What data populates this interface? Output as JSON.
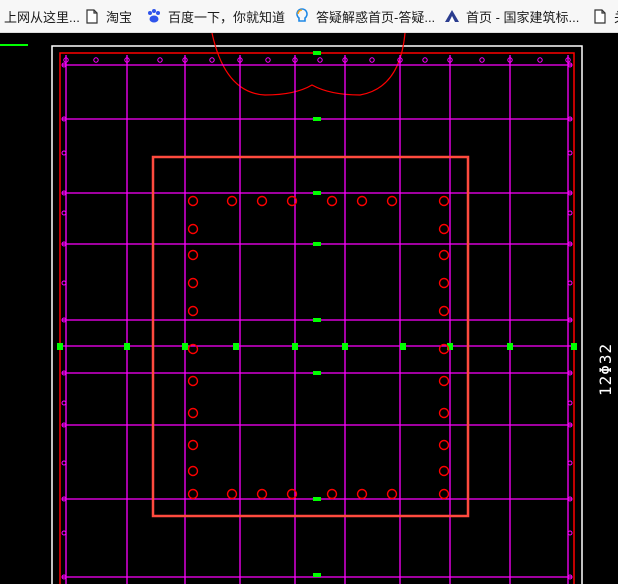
{
  "bookmarks": [
    {
      "label": "上网从这里...",
      "icon": "page-icon"
    },
    {
      "label": "淘宝",
      "icon": "page-icon"
    },
    {
      "label": "百度一下，你就知道",
      "icon": "baidu-paw-icon"
    },
    {
      "label": "答疑解惑首页-答疑...",
      "icon": "qa-bulb-icon"
    },
    {
      "label": "首页 - 国家建筑标...",
      "icon": "standards-logo-icon"
    },
    {
      "label": "关",
      "icon": "page-icon"
    }
  ],
  "cad": {
    "rebar_annotation": "12Φ32",
    "colors": {
      "background": "#000000",
      "grid": "#ff00ff",
      "border": "#ff0000",
      "outer_frame": "#ffffff",
      "marker": "#00ff00",
      "selection_box": "#ff4b3e"
    }
  }
}
